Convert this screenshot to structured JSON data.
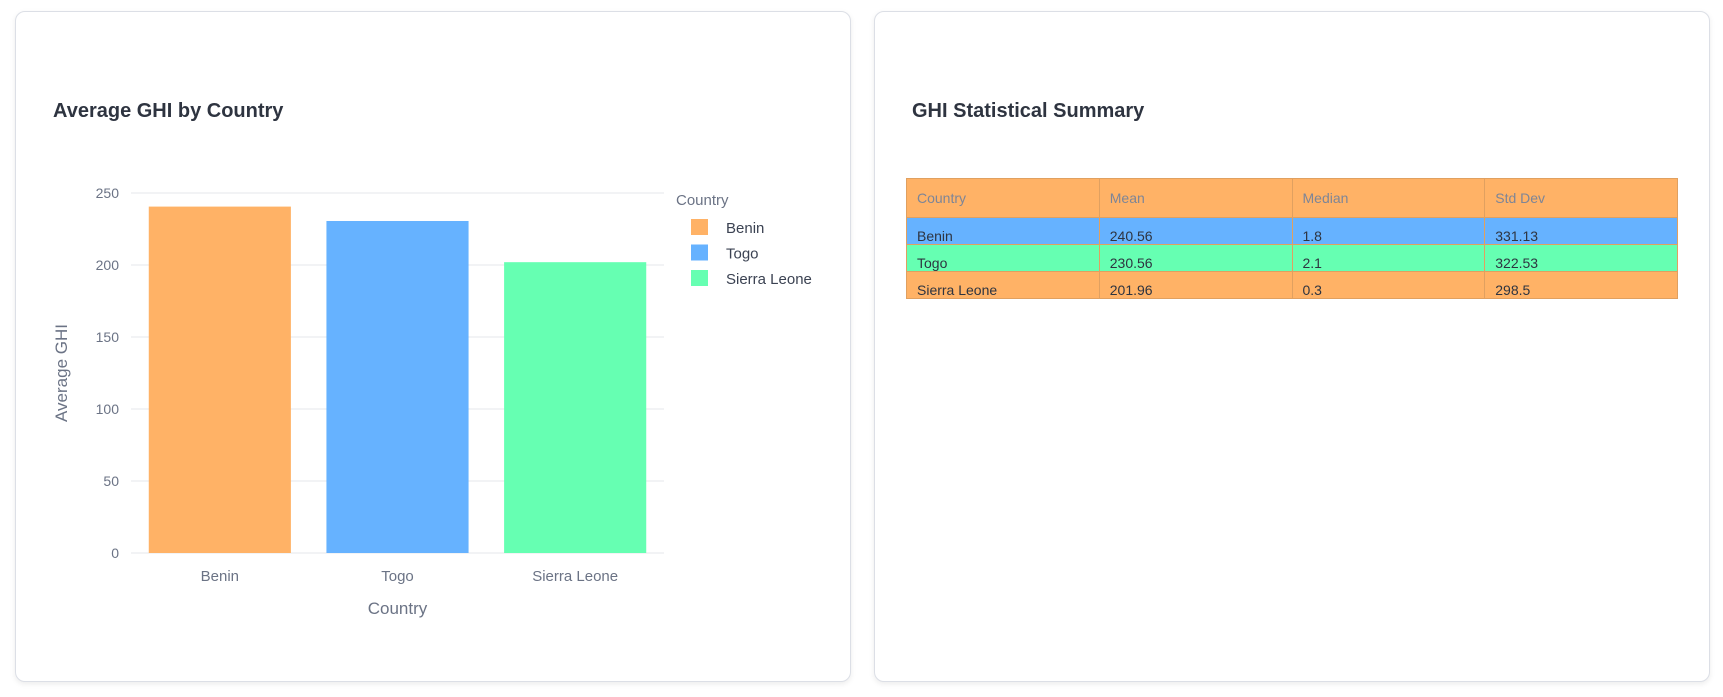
{
  "colors": {
    "benin": "#ffb266",
    "togo": "#66b2ff",
    "sierra_leone": "#66ffb2",
    "header": "#ffb266"
  },
  "chart_card": {
    "title": "Average GHI by Country"
  },
  "chart_data": {
    "type": "bar",
    "title": "Average GHI by Country",
    "xlabel": "Country",
    "ylabel": "Average GHI",
    "categories": [
      "Benin",
      "Togo",
      "Sierra Leone"
    ],
    "values": [
      240.56,
      230.56,
      201.96
    ],
    "ylim": [
      0,
      250
    ],
    "yticks": [
      0,
      50,
      100,
      150,
      200,
      250
    ],
    "grid": true,
    "legend": {
      "title": "Country",
      "placement": "top-right",
      "entries": [
        "Benin",
        "Togo",
        "Sierra Leone"
      ]
    }
  },
  "table_card": {
    "title": "GHI Statistical Summary",
    "columns": [
      "Country",
      "Mean",
      "Median",
      "Std Dev"
    ],
    "rows": [
      {
        "country": "Benin",
        "mean": "240.56",
        "median": "1.8",
        "std": "331.13",
        "color": "#66b2ff"
      },
      {
        "country": "Togo",
        "mean": "230.56",
        "median": "2.1",
        "std": "322.53",
        "color": "#66ffb2"
      },
      {
        "country": "Sierra Leone",
        "mean": "201.96",
        "median": "0.3",
        "std": "298.5",
        "color": "#ffb266"
      }
    ]
  }
}
